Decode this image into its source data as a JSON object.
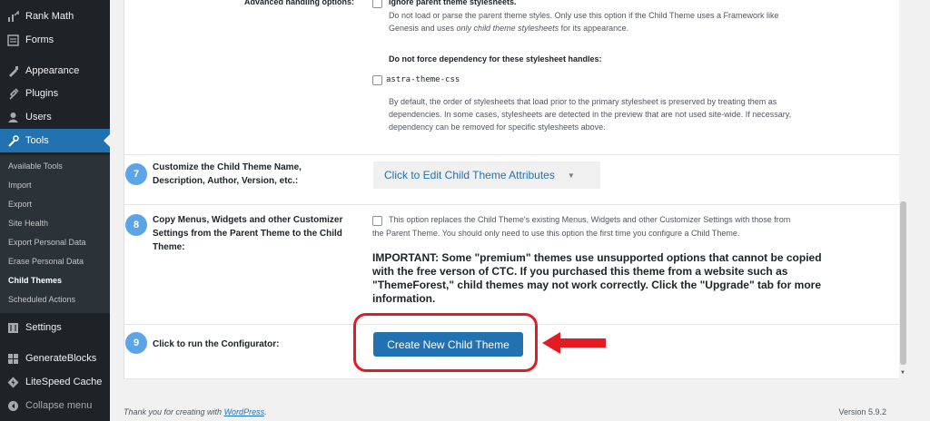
{
  "sidebar": {
    "menu": [
      {
        "label": "Rank Math",
        "icon": "rank-math-icon"
      },
      {
        "label": "Forms",
        "icon": "forms-icon"
      },
      {
        "label": "Appearance",
        "icon": "appearance-icon"
      },
      {
        "label": "Plugins",
        "icon": "plugins-icon"
      },
      {
        "label": "Users",
        "icon": "users-icon"
      },
      {
        "label": "Tools",
        "icon": "tools-icon"
      },
      {
        "label": "Settings",
        "icon": "settings-icon"
      },
      {
        "label": "GenerateBlocks",
        "icon": "generateblocks-icon"
      },
      {
        "label": "LiteSpeed Cache",
        "icon": "litespeed-icon"
      },
      {
        "label": "Collapse menu",
        "icon": "collapse-icon"
      }
    ],
    "submenu": [
      "Available Tools",
      "Import",
      "Export",
      "Site Health",
      "Export Personal Data",
      "Erase Personal Data",
      "Child Themes",
      "Scheduled Actions"
    ]
  },
  "advanced": {
    "label": "Advanced handling options:",
    "ignore_label": "Ignore parent theme stylesheets.",
    "ignore_desc_1": "Do not load or parse the parent theme styles. Only use this option if the Child Theme uses a Framework like",
    "ignore_desc_2a": "Genesis and uses ",
    "ignore_desc_2b": "only child theme stylesheets",
    "ignore_desc_2c": " for its appearance.",
    "force_heading": "Do not force dependency for these stylesheet handles:",
    "handle": "astra-theme-css",
    "dep_desc_1": "By default, the order of stylesheets that load prior to the primary stylesheet is preserved by treating them as",
    "dep_desc_2": "dependencies. In some cases, stylesheets are detected in the preview that are not used site-wide. If necessary,",
    "dep_desc_3": "dependency can be removed for specific stylesheets above."
  },
  "row7": {
    "number": "7",
    "label_1": "Customize the Child Theme Name,",
    "label_2": "Description, Author, Version, etc.:",
    "dropdown": "Click to Edit Child Theme Attributes"
  },
  "row8": {
    "number": "8",
    "label_1": "Copy Menus, Widgets and other Customizer",
    "label_2": "Settings from the Parent Theme to the Child",
    "label_3": "Theme:",
    "desc_1": "This option replaces the Child Theme's existing Menus, Widgets and other Customizer Settings with those from",
    "desc_2": "the Parent Theme. You should only need to use this option the first time you configure a Child Theme.",
    "important": "IMPORTANT: Some \"premium\" themes use unsupported options that cannot be copied with the free verson of CTC. If you purchased this theme from a website such as \"ThemeForest,\" child themes may not work correctly. Click the \"Upgrade\" tab for more information."
  },
  "row9": {
    "number": "9",
    "label": "Click to run the Configurator:",
    "button": "Create New Child Theme"
  },
  "footer": {
    "thanks_prefix": "Thank you for creating with ",
    "thanks_link": "WordPress",
    "thanks_suffix": ".",
    "version": "Version 5.9.2"
  },
  "colors": {
    "accent": "#2271b1",
    "sidebar_bg": "#1d2327",
    "badge": "#5ca4e8",
    "highlight": "#e31b23"
  }
}
